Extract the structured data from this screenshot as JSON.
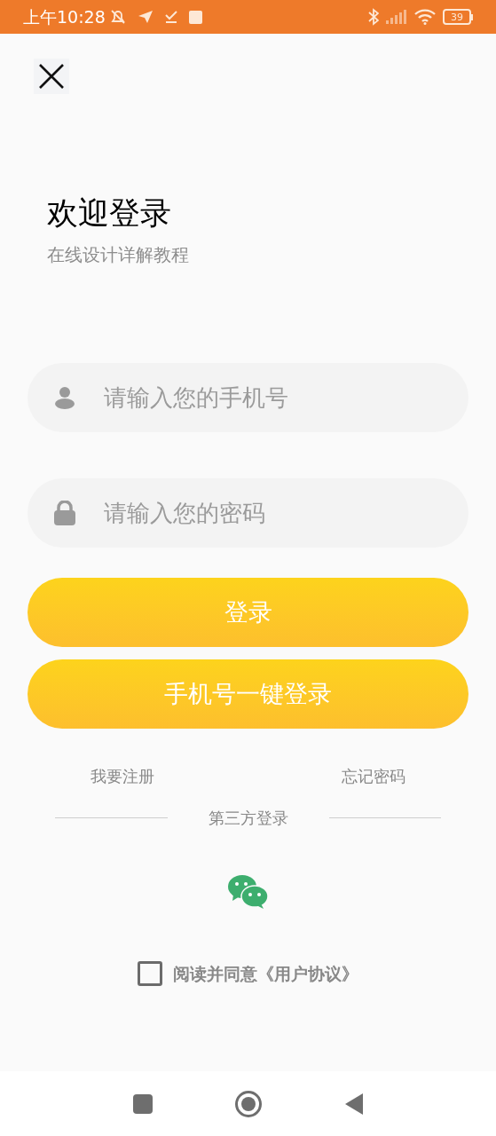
{
  "status_bar": {
    "time": "上午10:28",
    "battery": "39"
  },
  "title": "欢迎登录",
  "subtitle": "在线设计详解教程",
  "fields": [
    {
      "kind": "phone",
      "placeholder": "请输入您的手机号"
    },
    {
      "kind": "password",
      "placeholder": "请输入您的密码"
    }
  ],
  "buttons": [
    "登录",
    "手机号一键登录"
  ],
  "links": [
    "我要注册",
    "忘记密码"
  ],
  "third_party_label": "第三方登录",
  "agreement": {
    "label": "阅读并同意《用户协议》",
    "checked": false
  }
}
